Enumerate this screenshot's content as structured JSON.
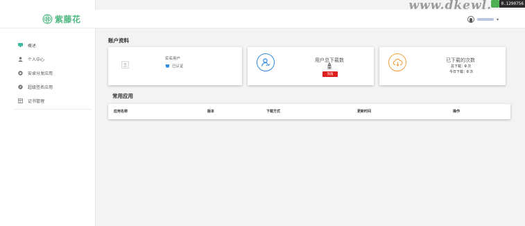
{
  "watermark": {
    "text": "www.dkewl.",
    "code": "0.1290756"
  },
  "header": {
    "logo_text": "紫藤花"
  },
  "sidebar": {
    "items": [
      {
        "label": "概述",
        "icon": "monitor-icon"
      },
      {
        "label": "个人中心",
        "icon": "user-icon"
      },
      {
        "label": "安卓分发应用",
        "icon": "android-icon"
      },
      {
        "label": "超级签名应用",
        "icon": "compass-icon"
      },
      {
        "label": "证书管理",
        "icon": "certificate-icon"
      }
    ]
  },
  "account": {
    "title": "账户资料",
    "profile": {
      "role": "实名用户",
      "status": "已认证"
    },
    "downloads_total": {
      "label": "用户总下载数量",
      "value": "0",
      "button": "充值"
    },
    "downloaded_times": {
      "label": "已下载的次数",
      "total_label": "总下载：",
      "total_value": "0",
      "total_unit": "次",
      "today_label": "今日下载：",
      "today_value": "0",
      "today_unit": "次"
    }
  },
  "apps": {
    "title": "常用应用",
    "columns": [
      "应用名称",
      "版本",
      "下载方式",
      "更新时间",
      "操作"
    ]
  },
  "colors": {
    "accent": "#52b883",
    "blue": "#2f8be0",
    "orange": "#f0a040",
    "red": "#e01d1d"
  }
}
